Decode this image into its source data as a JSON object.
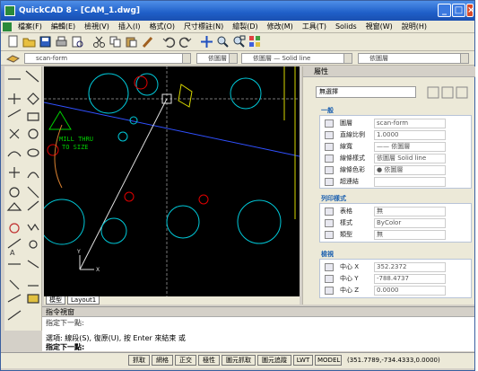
{
  "window": {
    "title": "QuickCAD 8 - [CAM_1.dwg]"
  },
  "menu": {
    "items": [
      "檔案(F)",
      "編輯(E)",
      "檢視(V)",
      "插入(I)",
      "格式(O)",
      "尺寸標註(N)",
      "繪製(D)",
      "修改(M)",
      "工具(T)",
      "Solids",
      "視窗(W)",
      "說明(H)"
    ]
  },
  "layers_toolbar": {
    "layer_combo": "scan-form",
    "color_combo": "依圖層",
    "linetype_combo": "依圖層 — Solid line",
    "lineweight_combo": "依圖層"
  },
  "canvas": {
    "annotation_line1": "MILL THRU",
    "annotation_line2": "TO SIZE",
    "axis_y": "Y",
    "axis_x": "X"
  },
  "tabs": [
    "模型",
    "Layout1"
  ],
  "properties": {
    "title": "屬性",
    "selection": "無選擇",
    "general_header": "一般",
    "general": [
      {
        "label": "圖層",
        "value": "scan-form"
      },
      {
        "label": "直線比例",
        "value": "1.0000"
      },
      {
        "label": "線寬",
        "value": "—— 依圖層"
      },
      {
        "label": "線條樣式",
        "value": "依圖層  Solid line"
      },
      {
        "label": "線條色彩",
        "value": "● 依圖層"
      },
      {
        "label": "超連結",
        "value": ""
      }
    ],
    "print_header": "列印樣式",
    "print": [
      {
        "label": "表格",
        "value": "無"
      },
      {
        "label": "樣式",
        "value": "ByColor"
      },
      {
        "label": "類型",
        "value": "無"
      }
    ],
    "view_header": "檢視",
    "view": [
      {
        "label": "中心 X",
        "value": "352.2372"
      },
      {
        "label": "中心 Y",
        "value": "-788.4737"
      },
      {
        "label": "中心 Z",
        "value": "0.0000"
      }
    ]
  },
  "command": {
    "title": "指令視窗",
    "line0": "指定下一點:",
    "line1": "選項: 線段(S), 復原(U), 按 Enter 來結束 或",
    "line2": "指定下一點:"
  },
  "status": {
    "buttons": [
      "抓取",
      "網格",
      "正交",
      "極性",
      "圖元抓取",
      "圖元追蹤",
      "LWT",
      "MODEL"
    ],
    "coords": "(351.7789,-734.4333,0.0000)"
  },
  "colors": {
    "canvas_bg": "#000000",
    "cyan_geometry": "#00c8d8",
    "green_annotation": "#00d000",
    "red_points": "#e00000",
    "yellow_geometry": "#d8d800",
    "blue_line": "#3050ff"
  }
}
